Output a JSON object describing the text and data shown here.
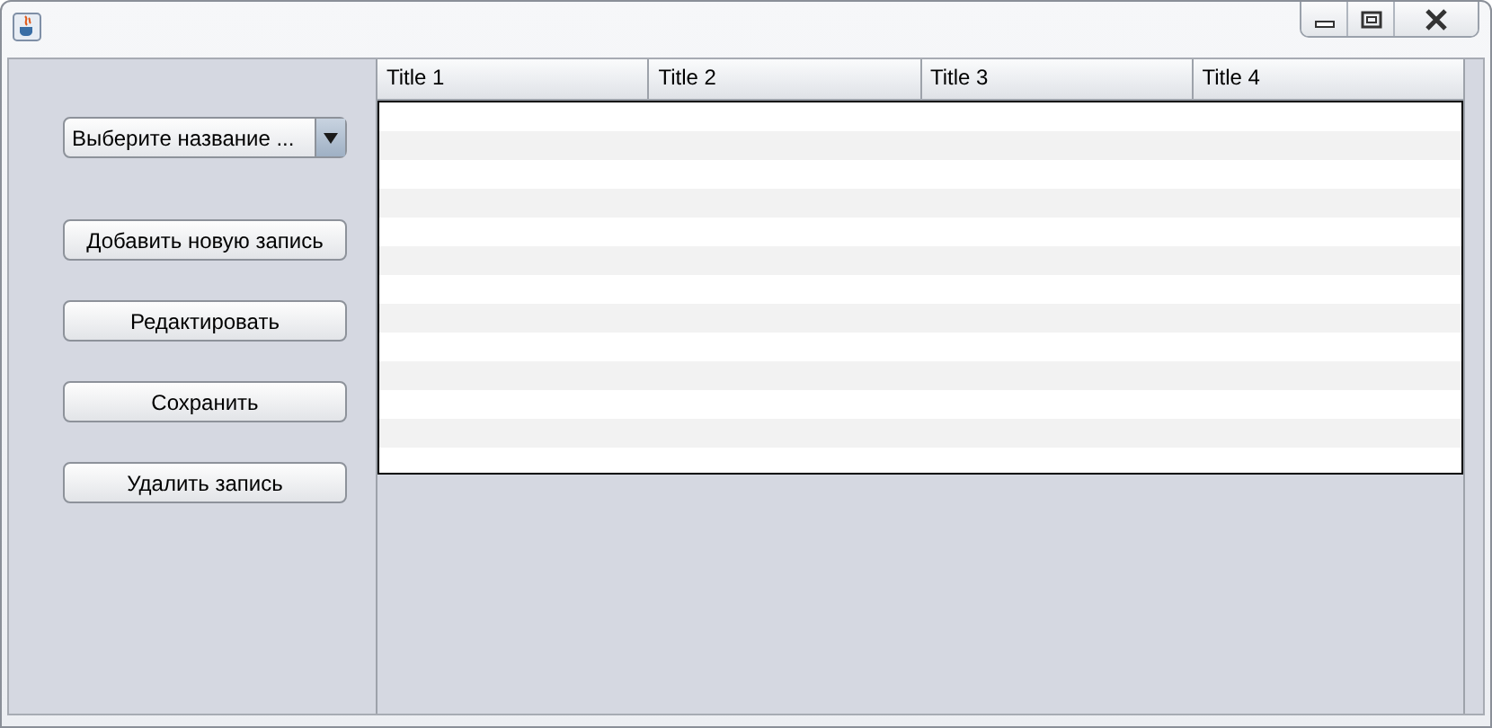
{
  "combo": {
    "value": "Выберите название ..."
  },
  "buttons": [
    "Добавить новую запись",
    "Редактировать",
    "Сохранить",
    "Удалить запись"
  ],
  "table": {
    "columns": [
      "Title 1",
      "Title 2",
      "Title 3",
      "Title 4"
    ]
  }
}
